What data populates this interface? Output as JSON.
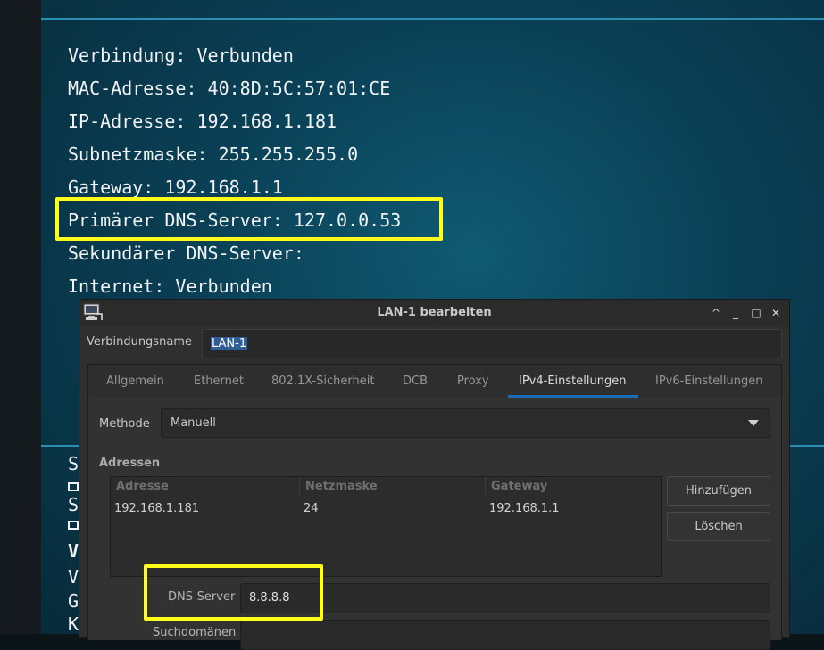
{
  "background": {
    "status_lines": [
      "Verbindung: Verbunden",
      "MAC-Adresse: 40:8D:5C:57:01:CE",
      "IP-Adresse: 192.168.1.181",
      "Subnetzmaske: 255.255.255.0",
      "Gateway: 192.168.1.1",
      "Primärer DNS-Server: 127.0.0.53",
      "Sekundärer DNS-Server:",
      "Internet: Verbunden"
    ],
    "lower_fragments": [
      "S",
      "S",
      "V",
      "V",
      "G",
      "K"
    ],
    "highlight_color": "#ffff1a"
  },
  "dialog": {
    "title": "LAN-1 bearbeiten",
    "window_buttons": [
      "^",
      "_",
      "□",
      "✕"
    ],
    "connection_name_label": "Verbindungsname",
    "connection_name_value": "LAN-1",
    "tabs": [
      {
        "label": "Allgemein"
      },
      {
        "label": "Ethernet"
      },
      {
        "label": "802.1X-Sicherheit"
      },
      {
        "label": "DCB"
      },
      {
        "label": "Proxy"
      },
      {
        "label": "IPv4-Einstellungen"
      },
      {
        "label": "IPv6-Einstellungen"
      }
    ],
    "active_tab": "IPv4-Einstellungen",
    "method_label": "Methode",
    "method_value": "Manuell",
    "addresses_label": "Adressen",
    "address_table": {
      "headers": [
        "Adresse",
        "Netzmaske",
        "Gateway"
      ],
      "rows": [
        [
          "192.168.1.181",
          "24",
          "192.168.1.1"
        ]
      ]
    },
    "add_button": "Hinzufügen",
    "delete_button": "Löschen",
    "dns_label": "DNS-Server",
    "dns_value": "8.8.8.8",
    "search_domains_label": "Suchdomänen"
  }
}
